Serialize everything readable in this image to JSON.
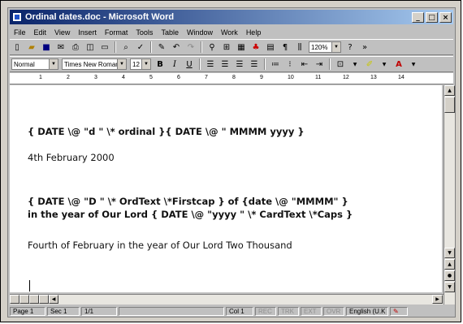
{
  "window": {
    "title": "Ordinal dates.doc - Microsoft Word",
    "controls": {
      "minimize": "_",
      "maximize": "□",
      "close": "×"
    }
  },
  "menu": [
    "File",
    "Edit",
    "View",
    "Insert",
    "Format",
    "Tools",
    "Table",
    "Window",
    "Work",
    "Help"
  ],
  "formatting": {
    "style": "Normal",
    "font": "Times New Roman",
    "size": "12",
    "zoom": "120%"
  },
  "ruler": {
    "marks": [
      "1",
      "2",
      "3",
      "4",
      "5",
      "6",
      "7",
      "8",
      "9",
      "10",
      "11",
      "12",
      "13",
      "14"
    ]
  },
  "document": {
    "line1": "{ DATE \\@ \"d \" \\* ordinal }{ DATE \\@ \" MMMM yyyy }",
    "line2": "4th February 2000",
    "line3": "{ DATE \\@ \"D \" \\* OrdText  \\*Firstcap } of {date \\@ \"MMMM\" }",
    "line4": "in the year of Our Lord { DATE \\@ \"yyyy \" \\* CardText \\*Caps }",
    "line5": "Fourth of February in the year of Our Lord Two Thousand"
  },
  "status": {
    "page": "Page 1",
    "section": "Sec 1",
    "pages": "1/1",
    "at": "",
    "col": "Col 1",
    "rec": "REC",
    "trk": "TRK",
    "ext": "EXT",
    "ovr": "OVR",
    "language": "English (U.K"
  }
}
